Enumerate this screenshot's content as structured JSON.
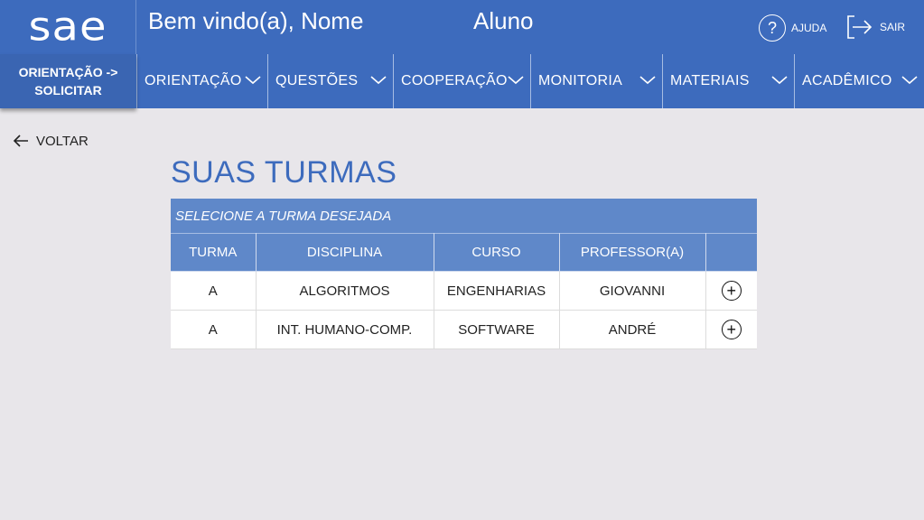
{
  "header": {
    "logo": "sae",
    "welcome": "Bem vindo(a), Nome",
    "role": "Aluno",
    "help_label": "AJUDA",
    "logout_label": "SAIR"
  },
  "nav": {
    "current_line1": "ORIENTAÇÃO ->",
    "current_line2": "SOLICITAR",
    "items": [
      {
        "label": "ORIENTAÇÃO"
      },
      {
        "label": "QUESTÕES"
      },
      {
        "label": "COOPERAÇÃO"
      },
      {
        "label": "MONITORIA"
      },
      {
        "label": "MATERIAIS"
      },
      {
        "label": "ACADÊMICO"
      }
    ]
  },
  "content": {
    "back_label": "VOLTAR",
    "title": "SUAS TURMAS",
    "caption": "SELECIONE A TURMA DESEJADA",
    "columns": [
      "TURMA",
      "DISCIPLINA",
      "CURSO",
      "PROFESSOR(A)",
      ""
    ],
    "rows": [
      {
        "turma": "A",
        "disciplina": "ALGORITMOS",
        "curso": "ENGENHARIAS",
        "professor": "GIOVANNI"
      },
      {
        "turma": "A",
        "disciplina": "INT. HUMANO-COMP.",
        "curso": "SOFTWARE",
        "professor": "ANDRÉ"
      }
    ]
  },
  "icons": {
    "help": "question-circle-icon",
    "logout": "logout-arrow-icon",
    "back": "arrow-left-icon",
    "add": "plus-circle-icon",
    "chevron": "chevron-down-icon"
  },
  "colors": {
    "primary": "#3d6bbd",
    "table_header": "#5f88c9",
    "background": "#e8e6ea"
  }
}
